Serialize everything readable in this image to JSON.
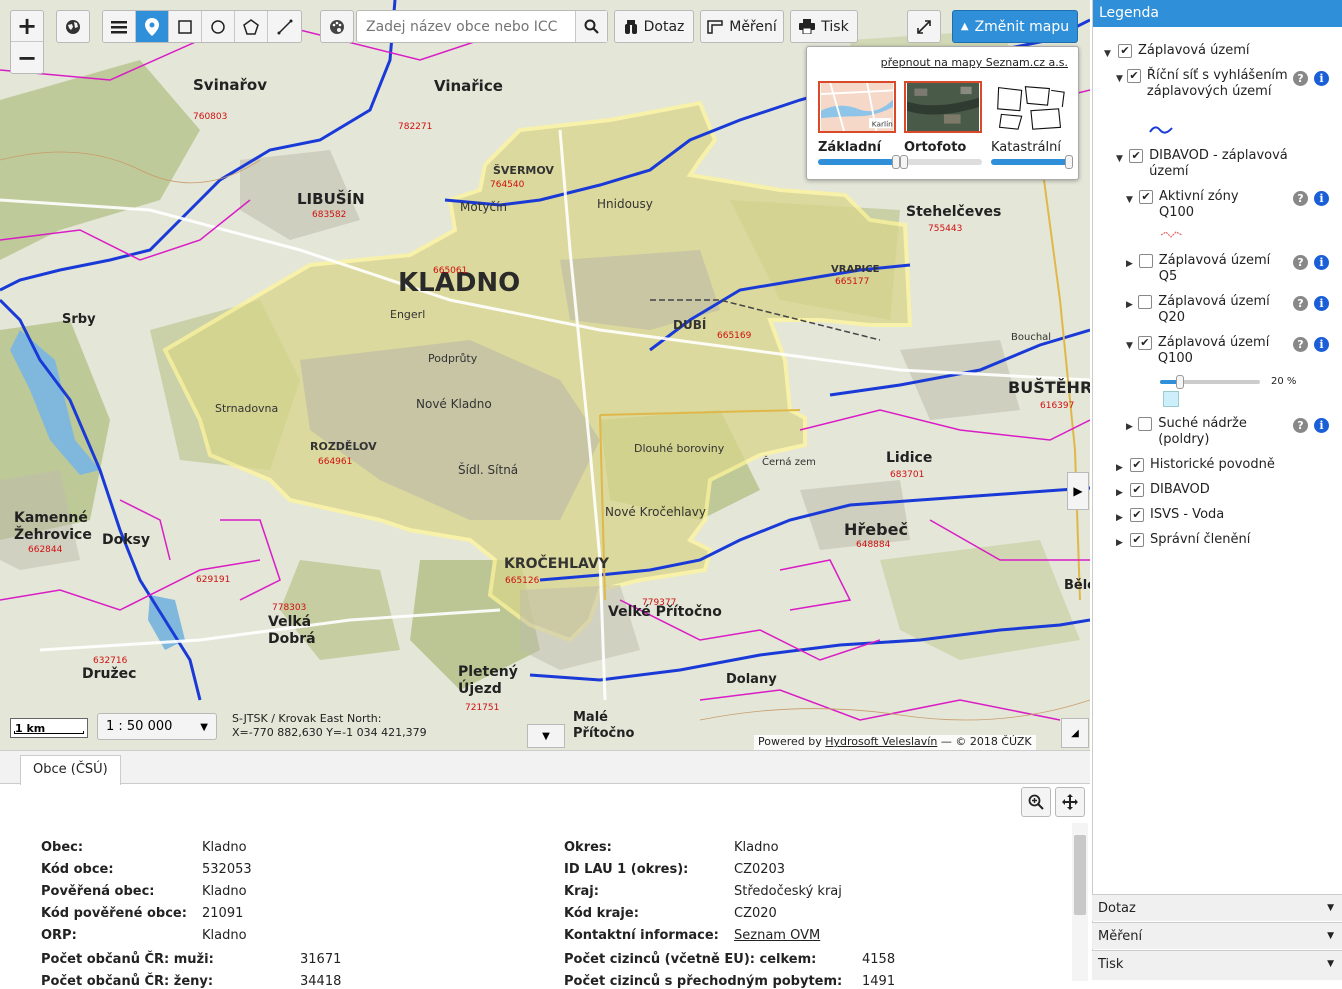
{
  "toolbar": {
    "zoom_in": "+",
    "zoom_out": "−",
    "search_placeholder": "Zadej název obce nebo ICC",
    "dotaz_label": "Dotaz",
    "mereni_label": "Měření",
    "tisk_label": "Tisk",
    "zmenit_mapu_label": "Změnit mapu"
  },
  "basemaps": {
    "link_text": "přepnout na mapy Seznam.cz a.s.",
    "items": [
      {
        "label": "Základní",
        "selected": true,
        "opacity": 100,
        "thumb_text": "Karlín"
      },
      {
        "label": "Ortofoto",
        "selected": true,
        "opacity": 0
      },
      {
        "label": "Katastrální",
        "selected": false,
        "opacity": 100
      }
    ]
  },
  "map_labels": {
    "kladno": "KLADNO",
    "kladno_code": "665061",
    "libusin": "LIBUŠÍN",
    "libusin_code": "683582",
    "svinarov": "Svinařov",
    "svinarov_code": "760803",
    "vinarice": "Vinařice",
    "vinarice_code": "782271",
    "svermov": "ŠVERMOV",
    "svermov_code": "764540",
    "motycin": "Motyčín",
    "hnidousy": "Hnidousy",
    "stehelceves": "Stehelčeves",
    "stehelceves_code": "755443",
    "vrapice": "VRAPICE",
    "vrapice_code": "665177",
    "dubi": "DUBÍ",
    "dubi_code": "665169",
    "bustehrad": "BUŠTĚHRAD",
    "bustehrad_code": "616397",
    "rozdelov": "ROZDĚLOV",
    "rozdelov_code": "664961",
    "krocehlavy": "KROČEHLAVY",
    "krocehlavy_code": "665126",
    "lidice": "Lidice",
    "lidice_code": "683701",
    "hrebec": "Hřebeč",
    "hrebec_code": "648884",
    "velke_pritocno": "Velké Přítočno",
    "velke_pritocno_code": "779377",
    "kamenne_zehrovice": "Kamenné Žehrovice",
    "kamenne_zehrovice_code": "662844",
    "doksy": "Doksy",
    "doksy_code": "629191",
    "velka_dobra": "Velká Dobrá",
    "velka_dobra_code": "778303",
    "druzec": "Družec",
    "druzec_code": "632716",
    "pletene_ujezd": "Pletený Újezd",
    "pletene_ujezd_code": "721751",
    "srby": "Srby",
    "dolany": "Dolany",
    "male_pritocno": "Malé Přítočno",
    "bouchal": "Bouchal",
    "cerna_zem": "Černá zem",
    "dlouhe_boroviny": "Dlouhé boroviny",
    "nova_kladno": "Nové Kladno",
    "sitna": "Šídl. Sítná",
    "nove_krocehlavy": "Nové Kročehlavy",
    "strnadovna": "Strnadovna",
    "engeri": "Engerl",
    "sr_kladno_ostrovec": "Podprůty",
    "beta": "Bělo"
  },
  "scale": {
    "bar_label": "1 km",
    "select_value": "1 : 50 000",
    "crs": "S-JTSK / Krovak East North:",
    "coords": "X=-770 882,630 Y=-1 034 421,379"
  },
  "attribution": {
    "prefix": "Powered by",
    "link": "Hydrosoft Veleslavín",
    "suffix": "— © 2018 ČÚZK"
  },
  "legend": {
    "title": "Legenda",
    "items": [
      {
        "label": "Záplavová území"
      },
      {
        "label": "Říční síť s vyhlášením záplavových území"
      },
      {
        "label": "DIBAVOD - záplavová území"
      },
      {
        "label": "Aktivní zóny Q100"
      },
      {
        "label": "Záplavová území Q5"
      },
      {
        "label": "Záplavová území Q20"
      },
      {
        "label": "Záplavová území Q100"
      },
      {
        "label": "Suché nádrže (poldry)"
      },
      {
        "label": "Historické povodně"
      },
      {
        "label": "DIBAVOD"
      },
      {
        "label": "ISVS - Voda"
      },
      {
        "label": "Správní členění"
      }
    ],
    "q100_opacity": "20 %",
    "q100_opacity_value": 0.2
  },
  "accordions": [
    {
      "label": "Dotaz"
    },
    {
      "label": "Měření"
    },
    {
      "label": "Tisk"
    }
  ],
  "bottom": {
    "tab": "Obce (ČSÚ)",
    "left": [
      {
        "label": "Obec:",
        "value": "Kladno"
      },
      {
        "label": "Kód obce:",
        "value": "532053"
      },
      {
        "label": "Pověřená obec:",
        "value": "Kladno"
      },
      {
        "label": "Kód pověřené obce:",
        "value": "21091"
      },
      {
        "label": "ORP:",
        "value": "Kladno"
      },
      {
        "label": "Počet občanů ČR: muži:",
        "value": "31671"
      },
      {
        "label": "Počet občanů ČR: ženy:",
        "value": "34418"
      }
    ],
    "right": [
      {
        "label": "Okres:",
        "value": "Kladno"
      },
      {
        "label": "ID LAU 1 (okres):",
        "value": "CZ0203"
      },
      {
        "label": "Kraj:",
        "value": "Středočeský kraj"
      },
      {
        "label": "Kód kraje:",
        "value": "CZ020"
      },
      {
        "label": "Kontaktní informace:",
        "value": "Seznam OVM"
      },
      {
        "label": "Počet cizinců (včetně EU): celkem:",
        "value": "4158"
      },
      {
        "label": "Počet cizinců s přechodným pobytem:",
        "value": "1491"
      }
    ]
  }
}
